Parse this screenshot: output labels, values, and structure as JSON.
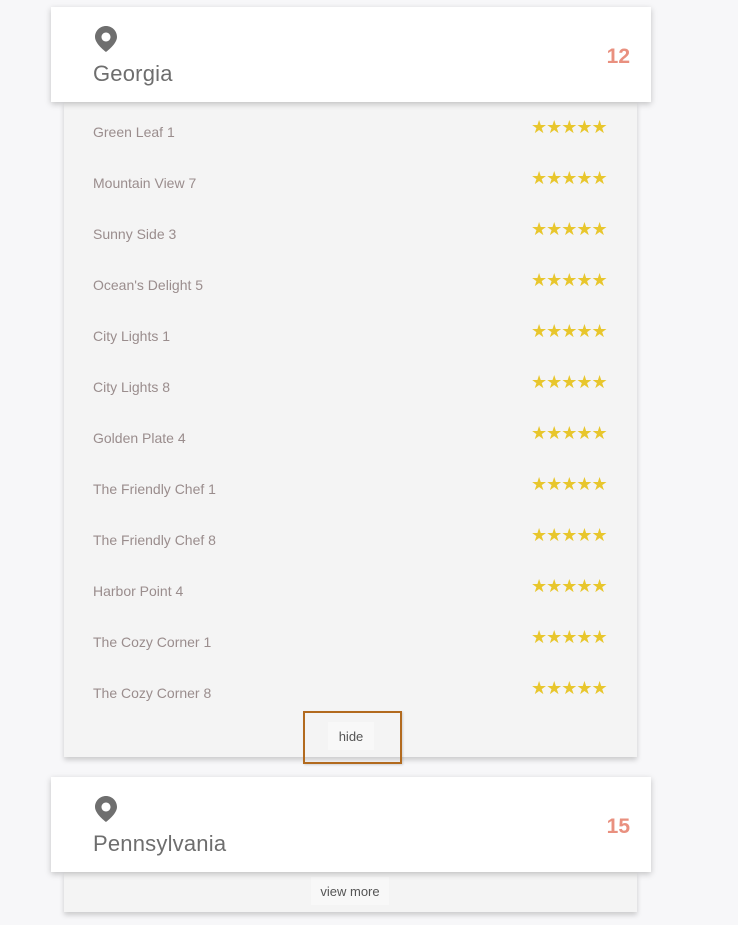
{
  "states": [
    {
      "name": "Georgia",
      "count": "12",
      "restaurants": [
        {
          "name": "Green Leaf 1",
          "rating": "★★★★★"
        },
        {
          "name": "Mountain View 7",
          "rating": "★★★★★"
        },
        {
          "name": "Sunny Side 3",
          "rating": "★★★★★"
        },
        {
          "name": "Ocean's Delight 5",
          "rating": "★★★★★"
        },
        {
          "name": "City Lights 1",
          "rating": "★★★★★"
        },
        {
          "name": "City Lights 8",
          "rating": "★★★★★"
        },
        {
          "name": "Golden Plate 4",
          "rating": "★★★★★"
        },
        {
          "name": "The Friendly Chef 1",
          "rating": "★★★★★"
        },
        {
          "name": "The Friendly Chef 8",
          "rating": "★★★★★"
        },
        {
          "name": "Harbor Point 4",
          "rating": "★★★★★"
        },
        {
          "name": "The Cozy Corner 1",
          "rating": "★★★★★"
        },
        {
          "name": "The Cozy Corner 8",
          "rating": "★★★★★"
        }
      ],
      "toggle_label": "hide"
    },
    {
      "name": "Pennsylvania",
      "count": "15",
      "toggle_label": "view more"
    }
  ],
  "colors": {
    "count": "#e9907f",
    "stars": "#e8c62c",
    "highlight": "#b26a1e"
  },
  "icons": {
    "location": "map-pin-icon",
    "rating": "star-icon"
  }
}
